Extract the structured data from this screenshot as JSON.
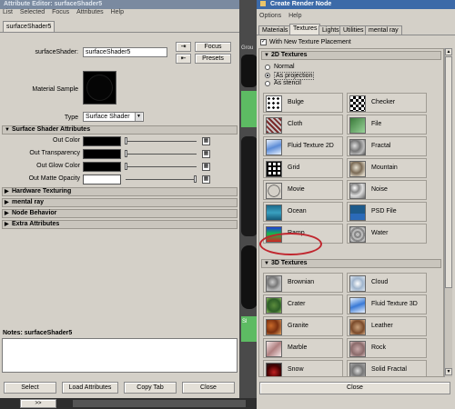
{
  "attribute_editor": {
    "title": "Attribute Editor: surfaceShader5",
    "menu": [
      "List",
      "Selected",
      "Focus",
      "Attributes",
      "Help"
    ],
    "node_tab": "surfaceShader5",
    "node_label": "surfaceShader:",
    "node_value": "surfaceShader5",
    "focus_label": "Focus",
    "presets_label": "Presets",
    "material_sample_label": "Material Sample",
    "type_label": "Type",
    "type_value": "Surface Shader",
    "sections": {
      "surface_shader": "Surface Shader Attributes",
      "hardware_texturing": "Hardware Texturing",
      "mental_ray": "mental ray",
      "node_behavior": "Node Behavior",
      "extra_attributes": "Extra Attributes"
    },
    "attributes": [
      {
        "label": "Out Color",
        "color": "#000000",
        "level": 0.0
      },
      {
        "label": "Out Transparency",
        "color": "#000000",
        "level": 0.0
      },
      {
        "label": "Out Glow Color",
        "color": "#000000",
        "level": 0.0
      },
      {
        "label": "Out Matte Opacity",
        "color": "#ffffff",
        "level": 1.0
      }
    ],
    "notes_label": "Notes: surfaceShader5",
    "buttons": [
      "Select",
      "Load Attributes",
      "Copy Tab",
      "Close"
    ]
  },
  "create_render_node": {
    "title": "Create Render Node",
    "menu": [
      "Options",
      "Help"
    ],
    "tabs": [
      "Materials",
      "Textures",
      "Lights",
      "Utilities",
      "mental ray"
    ],
    "active_tab": "Textures",
    "with_new_texture_placement": "With New Texture Placement",
    "tex2d_header": "2D Textures",
    "placement_options": [
      "Normal",
      "As projection",
      "As stencil"
    ],
    "placement_selected": "As projection",
    "textures_2d": [
      {
        "name": "Bulge",
        "icon": "bulge-thumb"
      },
      {
        "name": "Checker",
        "icon": "checker-thumb"
      },
      {
        "name": "Cloth",
        "icon": "cloth-thumb"
      },
      {
        "name": "File",
        "icon": "file-thumb"
      },
      {
        "name": "Fluid Texture 2D",
        "icon": "fluid2d-thumb"
      },
      {
        "name": "Fractal",
        "icon": "fractal-thumb"
      },
      {
        "name": "Grid",
        "icon": "grid-thumb"
      },
      {
        "name": "Mountain",
        "icon": "mountain-thumb"
      },
      {
        "name": "Movie",
        "icon": "movie-thumb"
      },
      {
        "name": "Noise",
        "icon": "noise-thumb"
      },
      {
        "name": "Ocean",
        "icon": "ocean-thumb"
      },
      {
        "name": "PSD File",
        "icon": "psd-thumb"
      },
      {
        "name": "Ramp",
        "icon": "ramp-thumb"
      },
      {
        "name": "Water",
        "icon": "water-thumb"
      }
    ],
    "tex3d_header": "3D Textures",
    "textures_3d": [
      {
        "name": "Brownian",
        "icon": "brownian-thumb"
      },
      {
        "name": "Cloud",
        "icon": "cloud-thumb"
      },
      {
        "name": "Crater",
        "icon": "crater-thumb"
      },
      {
        "name": "Fluid Texture 3D",
        "icon": "fluid3d-thumb"
      },
      {
        "name": "Granite",
        "icon": "granite-thumb"
      },
      {
        "name": "Leather",
        "icon": "leather-thumb"
      },
      {
        "name": "Marble",
        "icon": "marble-thumb"
      },
      {
        "name": "Rock",
        "icon": "rock-thumb"
      },
      {
        "name": "Snow",
        "icon": "snow-thumb"
      },
      {
        "name": "Solid Fractal",
        "icon": "solidfractal-thumb"
      }
    ],
    "close_label": "Close",
    "highlight_color": "#c0262e"
  },
  "background": {
    "partial_labels": [
      "Grou",
      "Sl"
    ]
  },
  "taskbar": {
    "arrows": ">>"
  }
}
